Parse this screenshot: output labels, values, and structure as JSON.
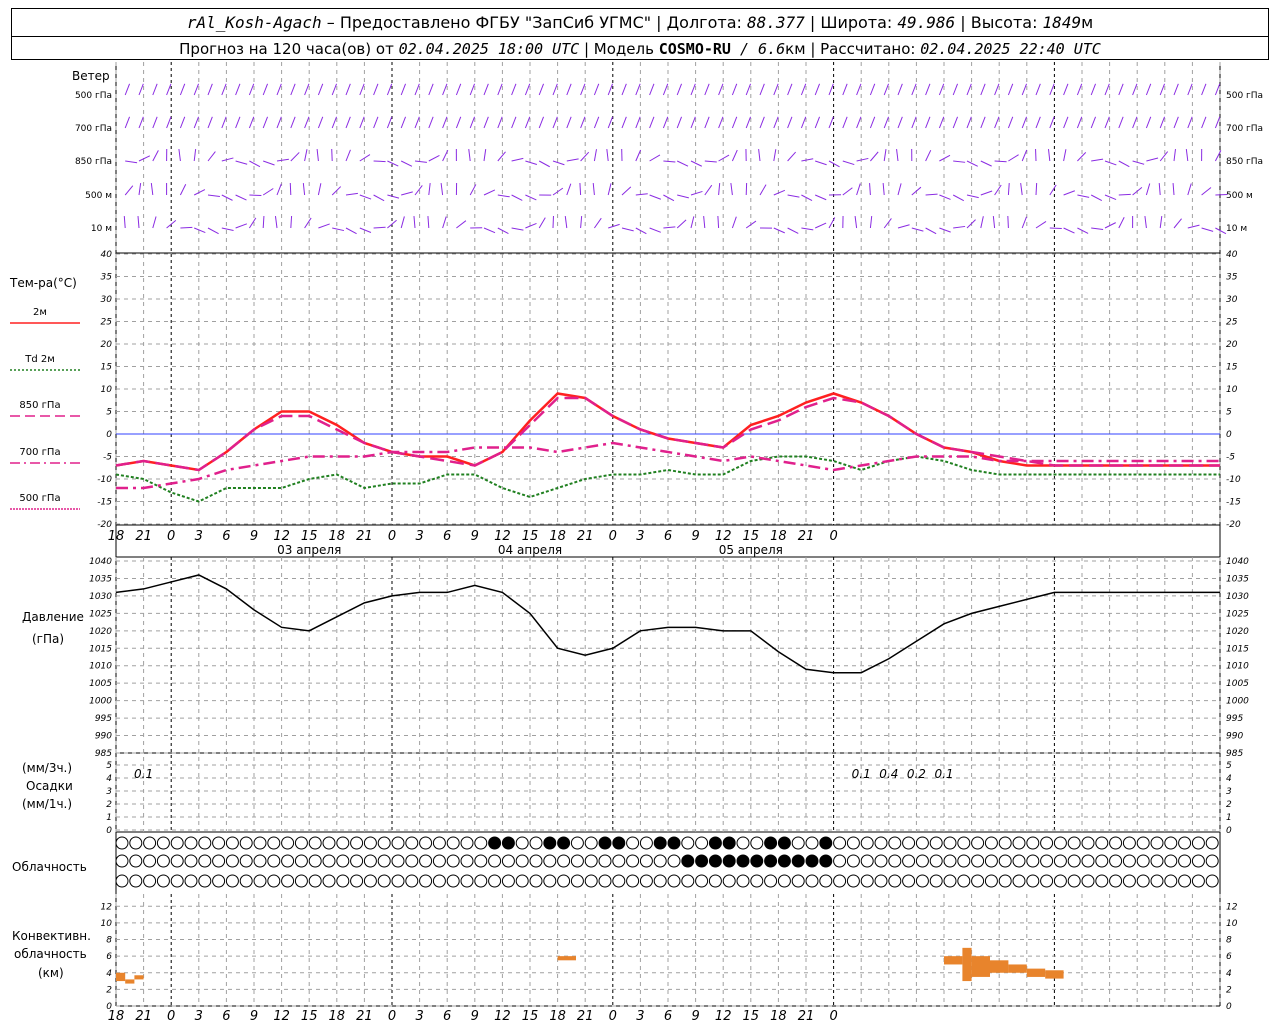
{
  "header": {
    "station": "rAl_Kosh-Agach",
    "provider": " – Предоставлено ФГБУ \"ЗапСиб УГМС\" | Долгота: ",
    "lon": "88.377",
    "lat_label": " | Широта: ",
    "lat": "49.986",
    "alt_label": " | Высота: ",
    "alt": "1849",
    "alt_unit": "м",
    "fc_label": "Прогноз на 120 часа(ов) от ",
    "fc_time": "02.04.2025 18:00 UTC",
    "model_label": "  | Модель ",
    "model": "COSMO-RU",
    "res": " / 6.6",
    "res_unit": "км",
    "calc_label": " | Рассчитано: ",
    "calc_time": "02.04.2025 22:40 UTC"
  },
  "wind_panel": {
    "title": "Ветер",
    "levels": [
      "500 гПа",
      "700 гПа",
      "850 гПа",
      "500 м",
      "10  м"
    ]
  },
  "temp_panel": {
    "title": "Тем-ра(°C)",
    "legend": [
      {
        "label": "2м",
        "color": "#ff2020",
        "style": "solid"
      },
      {
        "label": "Td  2м",
        "color": "#208020",
        "style": "dotted"
      },
      {
        "label": "850 гПа",
        "color": "#e0208c",
        "style": "dash"
      },
      {
        "label": "700 гПа",
        "color": "#e0208c",
        "style": "dashdot"
      },
      {
        "label": "500 гПа",
        "color": "#e0208c",
        "style": "dense"
      }
    ],
    "y_ticks": [
      "40",
      "35",
      "30",
      "25",
      "20",
      "15",
      "10",
      "5",
      "0",
      "-5",
      "-10",
      "-15",
      "-20"
    ]
  },
  "pressure_panel": {
    "title": "Давление",
    "unit": "(гПа)",
    "y_ticks": [
      "1040",
      "1035",
      "1030",
      "1025",
      "1020",
      "1015",
      "1010",
      "1005",
      "1000",
      "995",
      "990",
      "985"
    ]
  },
  "precip_panel": {
    "unit3": "(мм/3ч.)",
    "title": "Осадки",
    "unit1": "(мм/1ч.)",
    "y_ticks": [
      "5",
      "4",
      "3",
      "2",
      "1",
      "0"
    ],
    "amounts": [
      {
        "t": 3,
        "text": "0.1"
      },
      {
        "t": 81,
        "text": "0.1"
      },
      {
        "t": 84,
        "text": "0.4"
      },
      {
        "t": 87,
        "text": "0.2"
      },
      {
        "t": 90,
        "text": "0.1"
      }
    ]
  },
  "cloud_panel": {
    "title": "Облачность"
  },
  "conv_panel": {
    "title1": "Конвективн.",
    "title2": "облачность",
    "unit": "(км)",
    "y_ticks": [
      "12",
      "10",
      "8",
      "6",
      "4",
      "2",
      "0"
    ]
  },
  "time_axis": {
    "hour_labels": [
      "18",
      "21",
      "0",
      "3",
      "6",
      "9",
      "12",
      "15",
      "18",
      "21",
      "0",
      "3",
      "6",
      "9",
      "12",
      "15",
      "18",
      "21",
      "0",
      "3",
      "6",
      "9",
      "12",
      "15",
      "18",
      "21",
      "0"
    ],
    "day_labels": [
      {
        "t": 21,
        "text": "03 апреля"
      },
      {
        "t": 45,
        "text": "04 апреля"
      },
      {
        "t": 69,
        "text": "05 апреля"
      }
    ]
  },
  "chart_data": [
    {
      "type": "line",
      "title": "Тем-ра(°C)",
      "ylim": [
        -20,
        40
      ],
      "x_hours_from_start": [
        0,
        3,
        6,
        9,
        12,
        15,
        18,
        21,
        24,
        27,
        30,
        33,
        36,
        39,
        42,
        45,
        48,
        51,
        54,
        57,
        60,
        63,
        66,
        69,
        72,
        75,
        78,
        81,
        84,
        87,
        90,
        93,
        96,
        99,
        102,
        105,
        108,
        111,
        114,
        117,
        120
      ],
      "series": [
        {
          "name": "2м",
          "values": [
            -7,
            -6,
            -7,
            -8,
            -4,
            1,
            5,
            5,
            2,
            -2,
            -4,
            -5,
            -5,
            -7,
            -4,
            3,
            9,
            8,
            4,
            1,
            -1,
            -2,
            -3,
            2,
            4,
            7,
            9,
            7,
            4,
            0,
            -3,
            -4,
            -6,
            -7,
            -7,
            -7,
            -7,
            -7,
            -7,
            -7,
            -7
          ]
        },
        {
          "name": "Td  2м",
          "values": [
            -9,
            -10,
            -13,
            -15,
            -12,
            -12,
            -12,
            -10,
            -9,
            -12,
            -11,
            -11,
            -9,
            -9,
            -12,
            -14,
            -12,
            -10,
            -9,
            -9,
            -8,
            -9,
            -9,
            -6,
            -5,
            -5,
            -6,
            -8,
            -6,
            -5,
            -6,
            -8,
            -9,
            -9,
            -9,
            -9,
            -9,
            -9,
            -9,
            -9,
            -9
          ]
        },
        {
          "name": "850 гПа",
          "values": [
            -7,
            -6,
            -7,
            -8,
            -4,
            1,
            4,
            4,
            1,
            -2,
            -4,
            -5,
            -6,
            -7,
            -4,
            2,
            8,
            8,
            4,
            1,
            -1,
            -2,
            -3,
            1,
            3,
            6,
            8,
            7,
            4,
            0,
            -3,
            -4,
            -5,
            -6,
            -7,
            -7,
            -7,
            -7,
            -7,
            -7,
            -7
          ]
        },
        {
          "name": "700 гПа",
          "values": [
            -12,
            -12,
            -11,
            -10,
            -8,
            -7,
            -6,
            -5,
            -5,
            -5,
            -4,
            -4,
            -4,
            -3,
            -3,
            -3,
            -4,
            -3,
            -2,
            -3,
            -4,
            -5,
            -6,
            -5,
            -6,
            -7,
            -8,
            -7,
            -6,
            -5,
            -5,
            -5,
            -6,
            -6,
            -6,
            -6,
            -6,
            -6,
            -6,
            -6,
            -6
          ]
        }
      ]
    },
    {
      "type": "line",
      "title": "Давление",
      "ylim": [
        985,
        1040
      ],
      "x_hours_from_start": [
        0,
        3,
        6,
        9,
        12,
        15,
        18,
        21,
        24,
        27,
        30,
        33,
        36,
        39,
        42,
        45,
        48,
        51,
        54,
        57,
        60,
        63,
        66,
        69,
        72,
        75,
        78,
        81,
        84,
        87,
        90,
        93,
        96,
        99,
        102,
        105,
        108,
        111,
        114,
        117,
        120
      ],
      "series": [
        {
          "name": "Давление",
          "values": [
            1031,
            1032,
            1034,
            1036,
            1032,
            1026,
            1021,
            1020,
            1024,
            1028,
            1030,
            1031,
            1031,
            1033,
            1031,
            1025,
            1015,
            1013,
            1015,
            1020,
            1021,
            1021,
            1020,
            1020,
            1014,
            1009,
            1008,
            1008,
            1012,
            1017,
            1022,
            1025,
            1027,
            1029,
            1031,
            1031,
            1031,
            1031,
            1031,
            1031,
            1031
          ]
        }
      ]
    },
    {
      "type": "bar",
      "title": "Конвективн. облачность",
      "ylim": [
        0,
        13
      ],
      "segments": [
        {
          "t_start": 0,
          "t_end": 1,
          "bottom": 3,
          "top": 4
        },
        {
          "t_start": 1,
          "t_end": 2,
          "bottom": 2.7,
          "top": 3.2
        },
        {
          "t_start": 2,
          "t_end": 3,
          "bottom": 3.2,
          "top": 3.7
        },
        {
          "t_start": 48,
          "t_end": 50,
          "bottom": 5.5,
          "top": 6
        },
        {
          "t_start": 90,
          "t_end": 92,
          "bottom": 5,
          "top": 6
        },
        {
          "t_start": 92,
          "t_end": 93,
          "bottom": 3,
          "top": 7
        },
        {
          "t_start": 93,
          "t_end": 95,
          "bottom": 3.5,
          "top": 6
        },
        {
          "t_start": 95,
          "t_end": 97,
          "bottom": 4,
          "top": 5.5
        },
        {
          "t_start": 97,
          "t_end": 99,
          "bottom": 4,
          "top": 5
        },
        {
          "t_start": 99,
          "t_end": 101,
          "bottom": 3.5,
          "top": 4.5
        },
        {
          "t_start": 101,
          "t_end": 103,
          "bottom": 3.3,
          "top": 4.3
        }
      ]
    }
  ],
  "colors": {
    "t2m": "#ff2020",
    "td": "#208020",
    "t850": "#e0208c",
    "wind": "#8a2be2",
    "conv": "#e8842c",
    "grid": "#a0a0a0"
  }
}
